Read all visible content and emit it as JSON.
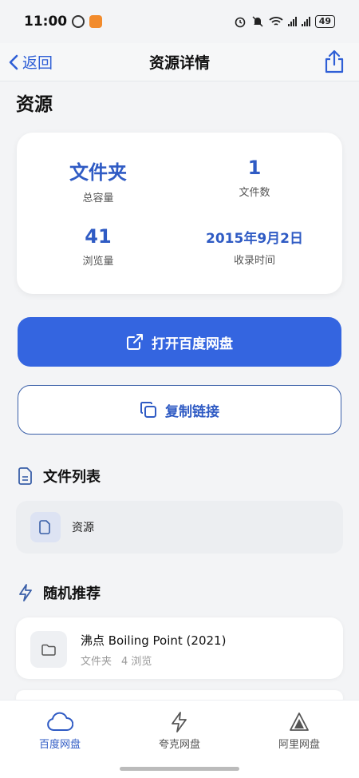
{
  "status_bar": {
    "time": "11:00",
    "battery": "49"
  },
  "nav": {
    "back_label": "返回",
    "title": "资源详情"
  },
  "page": {
    "title": "资源"
  },
  "stats": [
    {
      "value": "文件夹",
      "label": "总容量"
    },
    {
      "value": "1",
      "label": "文件数"
    },
    {
      "value": "41",
      "label": "浏览量"
    },
    {
      "value": "2015年9月2日",
      "label": "收录时间"
    }
  ],
  "actions": {
    "open_label": "打开百度网盘",
    "copy_label": "复制链接"
  },
  "file_list": {
    "title": "文件列表",
    "items": [
      {
        "name": "资源"
      }
    ]
  },
  "recommend": {
    "title": "随机推荐",
    "items": [
      {
        "title": "沸点 Boiling Point (2021)",
        "type": "文件夹",
        "views": "4 浏览"
      }
    ]
  },
  "tabs": [
    {
      "label": "百度网盘",
      "icon": "cloud-icon",
      "active": true
    },
    {
      "label": "夸克网盘",
      "icon": "bolt-icon",
      "active": false
    },
    {
      "label": "阿里网盘",
      "icon": "triangle-icon",
      "active": false
    }
  ],
  "colors": {
    "accent": "#3465e0",
    "accent_text": "#2f5bc4",
    "background": "#f3f4f6"
  }
}
